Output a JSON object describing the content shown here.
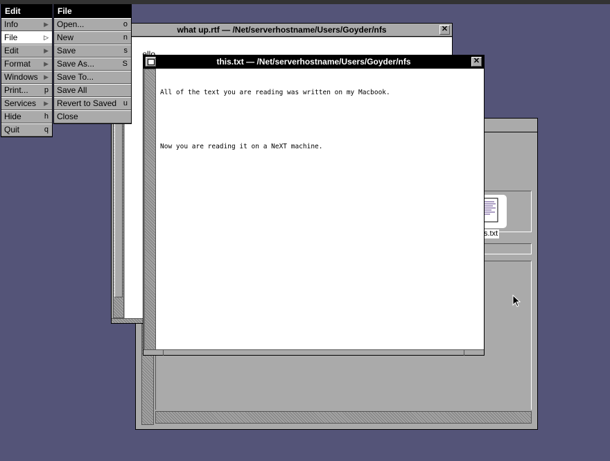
{
  "menus": {
    "edit_menu": {
      "title": "Edit",
      "items": [
        {
          "label": "Info",
          "key": "",
          "submenu": true
        },
        {
          "label": "File",
          "key": "",
          "submenu": true,
          "selected": true
        },
        {
          "label": "Edit",
          "key": "",
          "submenu": true
        },
        {
          "label": "Format",
          "key": "",
          "submenu": true
        },
        {
          "label": "Windows",
          "key": "",
          "submenu": true
        },
        {
          "label": "Print...",
          "key": "p",
          "submenu": false
        },
        {
          "label": "Services",
          "key": "",
          "submenu": true
        },
        {
          "label": "Hide",
          "key": "h",
          "submenu": false
        },
        {
          "label": "Quit",
          "key": "q",
          "submenu": false
        }
      ]
    },
    "file_menu": {
      "title": "File",
      "items": [
        {
          "label": "Open...",
          "key": "o"
        },
        {
          "label": "New",
          "key": "n"
        },
        {
          "label": "Save",
          "key": "s"
        },
        {
          "label": "Save As...",
          "key": "S"
        },
        {
          "label": "Save To...",
          "key": ""
        },
        {
          "label": "Save All",
          "key": ""
        },
        {
          "label": "Revert to Saved",
          "key": "u"
        },
        {
          "label": "Close",
          "key": ""
        }
      ]
    }
  },
  "windows": {
    "back_window": {
      "title": "what up.rtf  —  /Net/serverhostname/Users/Goyder/nfs",
      "content": "ello"
    },
    "front_window": {
      "title": "this.txt  —  /Net/serverhostname/Users/Goyder/nfs",
      "content_lines": [
        "All of the text you are reading was written on my Macbook.",
        "",
        "Now you are reading it on a NeXT machine."
      ]
    },
    "file_viewer": {
      "file_label": "s.txt"
    }
  },
  "icons": {
    "close": "close-x-icon",
    "miniaturize": "miniaturize-icon",
    "submenu": "submenu-arrow-icon",
    "cursor": "mouse-pointer-icon",
    "document": "text-document-icon"
  }
}
